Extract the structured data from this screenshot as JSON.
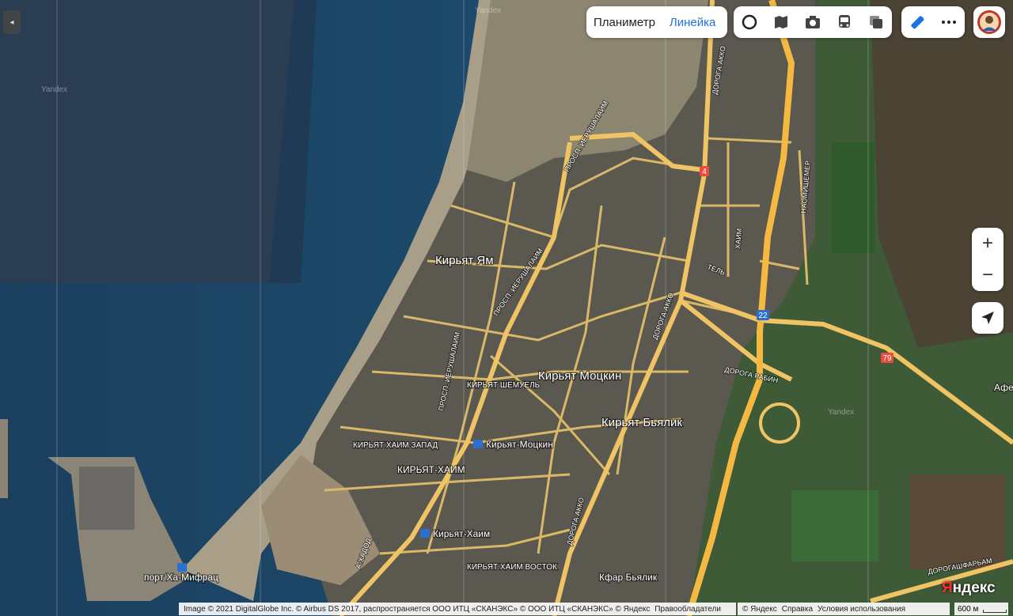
{
  "toolbar": {
    "planimeter_label": "Планиметр",
    "ruler_label": "Линейка"
  },
  "colors": {
    "active_blue": "#1a73e8",
    "road": "#e9c46a",
    "highway": "#f5b942",
    "sea": "#1d4a6b"
  },
  "controls": {
    "zoom_in": "+",
    "zoom_out": "−",
    "collapse": "◂"
  },
  "map_labels": {
    "kiryat_yam": "Кирьят Ям",
    "kiryat_motzkin": "Кирьят Моцкин",
    "kiryat_bialik": "Кирьят Бьялик",
    "kiryat_shmuel": "КИРЬЯТ ШЕМУЕЛЬ",
    "kiryat_haim_west": "КИРЬЯТ ХАИМ ЗАПАД",
    "kiryat_haim": "КИРЬЯТ-ХАИМ",
    "kiryat_haim_east": "КИРЬЯТ ХАИМ ВОСТОК",
    "kfar_bialik": "Кфар Бьялик",
    "station_motzkin": "Кирьят-Моцкин",
    "station_haim": "Кирьят-Хаим",
    "port": "порт Ха-Мифрац",
    "afek": "Афе",
    "road_akko_1": "ДОРОГА АККО",
    "road_akko_2": "ДОРОГА АККО",
    "road_akko_3": "ДОРОГА АККО",
    "road_rabin": "ДОРОГА РАБИН",
    "road_haifa": "ДОРОГАШФАРЬАМ",
    "prospect_jerusalem_1": "ПРОСП. ИЕРУШАЛАИМ",
    "prospect_jerusalem_2": "ПРОСП. ИЕРУШАЛАИМ",
    "prospect_jerusalem_3": "ПРОСП. ИЕРУШАЛАИМ",
    "haim": "ХАИМ",
    "tel": "ТЕЛЬ",
    "naomi_shemer": "НАОМИШЕМЕР",
    "a_hadod": "А-ХАДОД",
    "yandex_wm_1": "Yandex",
    "yandex_wm_2": "Yandex",
    "yandex_wm_3": "Yandex",
    "route_4": "4",
    "route_22": "22",
    "route_79": "79"
  },
  "footer": {
    "copyright": "Image © 2021 DigitalGlobe Inc. © Airbus DS 2017, распространяется ООО ИТЦ «СКАНЭКС» © ООО ИТЦ «СКАНЭКС» © Яндекс",
    "rights": "Правообладатели",
    "yandex_c": "© Яндекс",
    "help": "Справка",
    "terms": "Условия использования",
    "scale": "600 м"
  },
  "logo": {
    "text_red": "Я",
    "text_rest": "ндекс"
  }
}
